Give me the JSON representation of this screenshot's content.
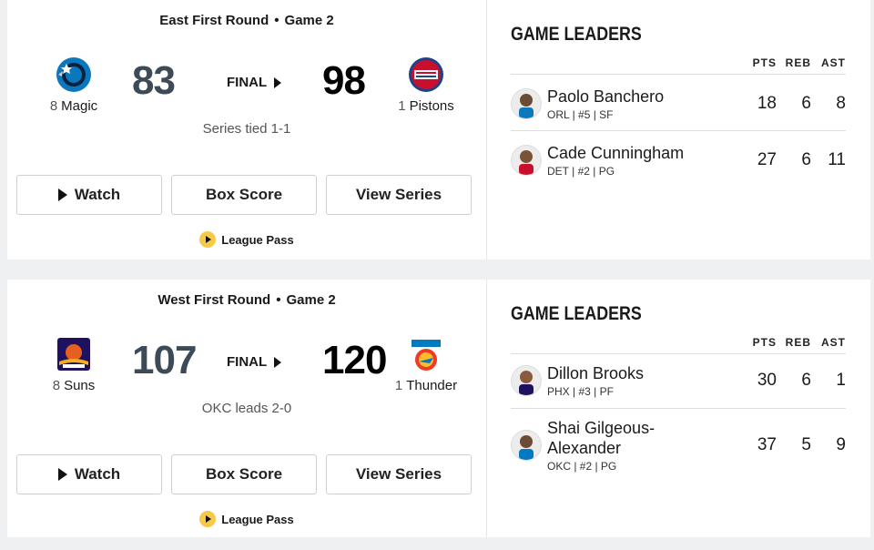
{
  "games": [
    {
      "round": "East First Round",
      "game": "Game 2",
      "away": {
        "seed": "8",
        "name": "Magic",
        "score": "83",
        "logo_icon": "orlando-magic-logo-icon"
      },
      "home": {
        "seed": "1",
        "name": "Pistons",
        "score": "98",
        "logo_icon": "detroit-pistons-logo-icon"
      },
      "status": "FINAL",
      "series": "Series tied 1-1",
      "buttons": {
        "watch": "Watch",
        "box_score": "Box Score",
        "view_series": "View Series"
      },
      "league_pass": "League Pass",
      "leaders": {
        "title": "GAME LEADERS",
        "headers": [
          "PTS",
          "REB",
          "AST"
        ],
        "players": [
          {
            "name": "Paolo Banchero",
            "meta": "ORL | #5 | SF",
            "pts": "18",
            "reb": "6",
            "ast": "8"
          },
          {
            "name": "Cade Cunningham",
            "meta": "DET | #2 | PG",
            "pts": "27",
            "reb": "6",
            "ast": "11"
          }
        ]
      }
    },
    {
      "round": "West First Round",
      "game": "Game 2",
      "away": {
        "seed": "8",
        "name": "Suns",
        "score": "107",
        "logo_icon": "phoenix-suns-logo-icon"
      },
      "home": {
        "seed": "1",
        "name": "Thunder",
        "score": "120",
        "logo_icon": "okc-thunder-logo-icon"
      },
      "status": "FINAL",
      "series": "OKC leads 2-0",
      "buttons": {
        "watch": "Watch",
        "box_score": "Box Score",
        "view_series": "View Series"
      },
      "league_pass": "League Pass",
      "leaders": {
        "title": "GAME LEADERS",
        "headers": [
          "PTS",
          "REB",
          "AST"
        ],
        "players": [
          {
            "name": "Dillon Brooks",
            "meta": "PHX | #3 | PF",
            "pts": "30",
            "reb": "6",
            "ast": "1"
          },
          {
            "name": "Shai Gilgeous-Alexander",
            "meta": "OKC | #2 | PG",
            "pts": "37",
            "reb": "5",
            "ast": "9"
          }
        ]
      }
    }
  ],
  "colors": {
    "accent": "#f7c948",
    "away_score": "#3d4a57",
    "home_score": "#000000",
    "magic": "#0b77bd",
    "pistons": "#c8102e",
    "suns": "#1d1160",
    "thunder": "#007ac1"
  }
}
